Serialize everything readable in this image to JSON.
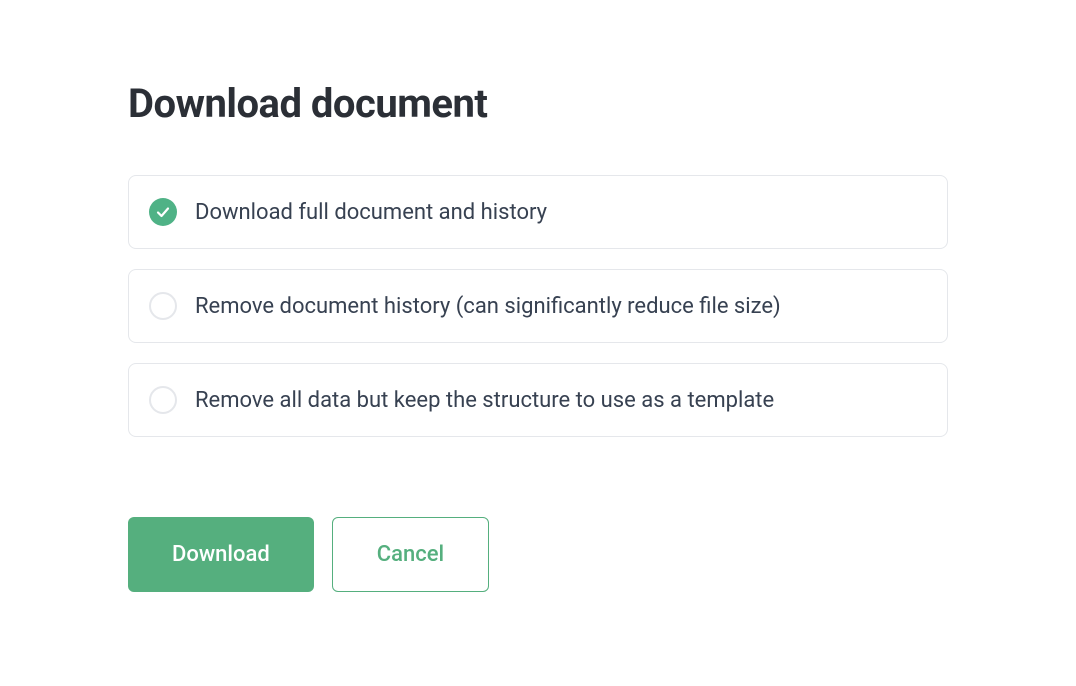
{
  "dialog": {
    "title": "Download document",
    "options": [
      {
        "label": "Download full document and history",
        "selected": true
      },
      {
        "label": "Remove document history (can significantly reduce file size)",
        "selected": false
      },
      {
        "label": "Remove all data but keep the structure to use as a template",
        "selected": false
      }
    ],
    "buttons": {
      "primary": "Download",
      "secondary": "Cancel"
    }
  }
}
